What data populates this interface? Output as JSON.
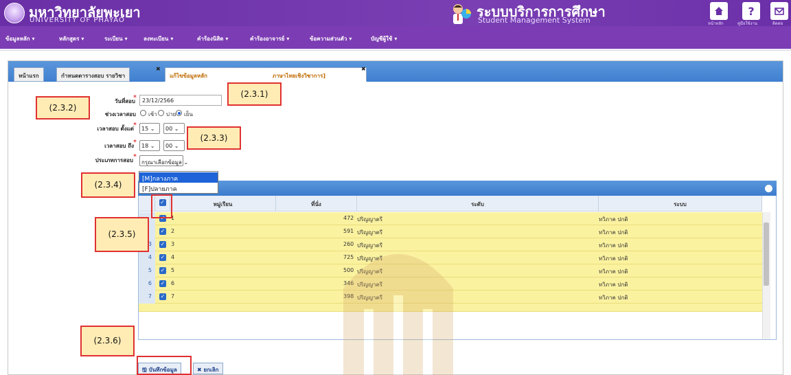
{
  "header": {
    "university_th": "มหาวิทยาลัยพะเยา",
    "university_en": "UNIVERSITY OF PHAYAO",
    "system_th": "ระบบบริการการศึกษา",
    "system_en": "Student Management System",
    "buttons": [
      {
        "icon": "home-icon",
        "label": "หน้าหลัก"
      },
      {
        "icon": "help-icon",
        "label": "คู่มือใช้งาน"
      },
      {
        "icon": "mail-icon",
        "label": "ติดต่อ"
      }
    ]
  },
  "menu": {
    "items": [
      "ข้อมูลหลัก",
      "หลักสูตร",
      "ระเบียน",
      "ลงทะเบียน",
      "คำร้องนิสิต",
      "คำร้องอาจารย์",
      "ข้อความส่วนตัว",
      "บัญชีผู้ใช้"
    ]
  },
  "tabs": [
    {
      "label": "หน้าแรก",
      "active": false
    },
    {
      "label": "กำหนดตารางสอบ รายวิชา",
      "active": false
    },
    {
      "label": "แก้ไขข้อมูลหลัก",
      "suffix": "ภาษาไทยเชิงวิชาการ]",
      "active": true
    }
  ],
  "form": {
    "exam_date_label": "วันที่สอบ",
    "exam_date_value": "23/12/2566",
    "period_label": "ช่วงเวลาสอบ",
    "period_options": [
      "เช้า",
      "บ่าย",
      "เย็น"
    ],
    "period_selected": "เย็น",
    "start_label": "เวลาสอบ ตั้งแต่",
    "start_hour": "15",
    "start_min": "00",
    "end_label": "เวลาสอบ ถึง",
    "end_hour": "18",
    "end_min": "00",
    "type_label": "ประเภทการสอบ",
    "type_placeholder": "กรุณาเลือกข้อมูล",
    "type_options": [
      "[M]กลางภาค",
      "[F]ปลายภาค"
    ]
  },
  "table": {
    "columns": [
      "หมู่เรียน",
      "ที่นั่ง",
      "ระดับ",
      "ระบบ"
    ],
    "rows": [
      {
        "num": "",
        "group": "1",
        "seats": "472",
        "level": "ปริญญาตรี",
        "system": "ทวิภาค ปกติ"
      },
      {
        "num": "",
        "group": "2",
        "seats": "591",
        "level": "ปริญญาตรี",
        "system": "ทวิภาค ปกติ"
      },
      {
        "num": "3",
        "group": "3",
        "seats": "260",
        "level": "ปริญญาตรี",
        "system": "ทวิภาค ปกติ"
      },
      {
        "num": "4",
        "group": "4",
        "seats": "725",
        "level": "ปริญญาตรี",
        "system": "ทวิภาค ปกติ"
      },
      {
        "num": "5",
        "group": "5",
        "seats": "500",
        "level": "ปริญญาตรี",
        "system": "ทวิภาค ปกติ"
      },
      {
        "num": "6",
        "group": "6",
        "seats": "346",
        "level": "ปริญญาตรี",
        "system": "ทวิภาค ปกติ"
      },
      {
        "num": "7",
        "group": "7",
        "seats": "398",
        "level": "ปริญญาตรี",
        "system": "ทวิภาค ปกติ"
      }
    ]
  },
  "buttons": {
    "save": "บันทึกข้อมูล",
    "cancel": "ยกเลิก"
  },
  "annotations": [
    "(2.3.1)",
    "(2.3.2)",
    "(2.3.3)",
    "(2.3.4)",
    "(2.3.5)",
    "(2.3.6)"
  ],
  "colors": {
    "header": "#6a2fa6",
    "menubar": "#7c3cb3",
    "tab_blue": "#3f7fcf",
    "row_yellow": "#fbf2a0",
    "annotation_border": "#e03030",
    "annotation_fill": "#ffecb5"
  }
}
